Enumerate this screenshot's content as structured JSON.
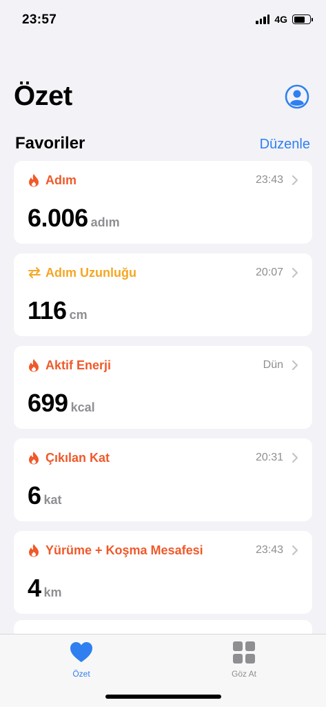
{
  "status_bar": {
    "time": "23:57",
    "network": "4G"
  },
  "header": {
    "title": "Özet"
  },
  "section": {
    "title": "Favoriler",
    "edit_label": "Düzenle"
  },
  "colors": {
    "accent": "#2f7ff0",
    "energy": "#f0592a",
    "mobility": "#f5a623",
    "secondary": "#8e8e93"
  },
  "cards": [
    {
      "icon": "flame-icon",
      "title": "Adım",
      "time": "23:43",
      "value": "6.006",
      "unit": "adım",
      "color": "#f0592a"
    },
    {
      "icon": "arrows-icon",
      "title": "Adım Uzunluğu",
      "time": "20:07",
      "value": "116",
      "unit": "cm",
      "color": "#f5a623"
    },
    {
      "icon": "flame-icon",
      "title": "Aktif Enerji",
      "time": "Dün",
      "value": "699",
      "unit": "kcal",
      "color": "#f0592a"
    },
    {
      "icon": "flame-icon",
      "title": "Çıkılan Kat",
      "time": "20:31",
      "value": "6",
      "unit": "kat",
      "color": "#f0592a"
    },
    {
      "icon": "flame-icon",
      "title": "Yürüme + Koşma Mesafesi",
      "time": "23:43",
      "value": "4",
      "unit": "km",
      "color": "#f0592a"
    }
  ],
  "tabs": [
    {
      "label": "Özet",
      "icon": "heart-icon",
      "active": true
    },
    {
      "label": "Göz At",
      "icon": "grid-icon",
      "active": false
    }
  ]
}
